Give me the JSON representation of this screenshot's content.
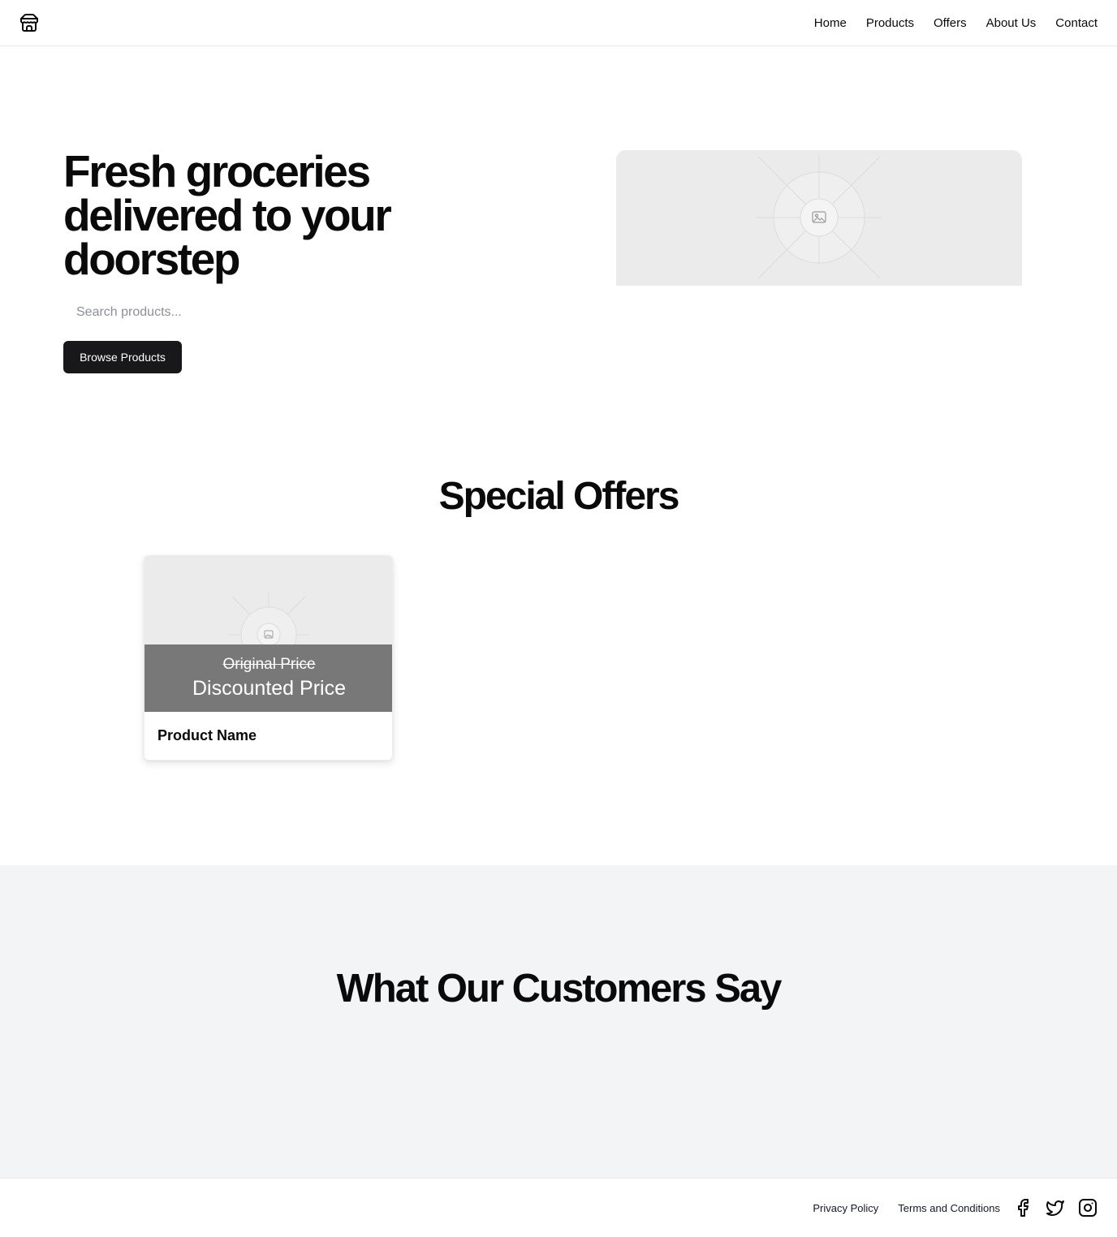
{
  "header": {
    "logo_icon": "store-icon",
    "nav": [
      {
        "label": "Home"
      },
      {
        "label": "Products"
      },
      {
        "label": "Offers"
      },
      {
        "label": "About Us"
      },
      {
        "label": "Contact"
      }
    ]
  },
  "hero": {
    "title": "Fresh groceries delivered to your doorstep",
    "search_placeholder": "Search products...",
    "browse_label": "Browse Products",
    "image_icon": "image-placeholder-icon"
  },
  "offers": {
    "title": "Special Offers",
    "products": [
      {
        "original_price": "Original Price",
        "discounted_price": "Discounted Price",
        "name": "Product Name",
        "image_icon": "image-placeholder-icon"
      }
    ]
  },
  "testimonials": {
    "title": "What Our Customers Say"
  },
  "footer": {
    "links": [
      {
        "label": "Privacy Policy"
      },
      {
        "label": "Terms and Conditions"
      }
    ],
    "social_icons": [
      "facebook-icon",
      "twitter-icon",
      "instagram-icon"
    ]
  },
  "colors": {
    "primary_button": "#18181b",
    "testimonials_bg": "#f3f4f6",
    "image_placeholder": "#ebebeb",
    "price_overlay": "#6e6e6e"
  }
}
